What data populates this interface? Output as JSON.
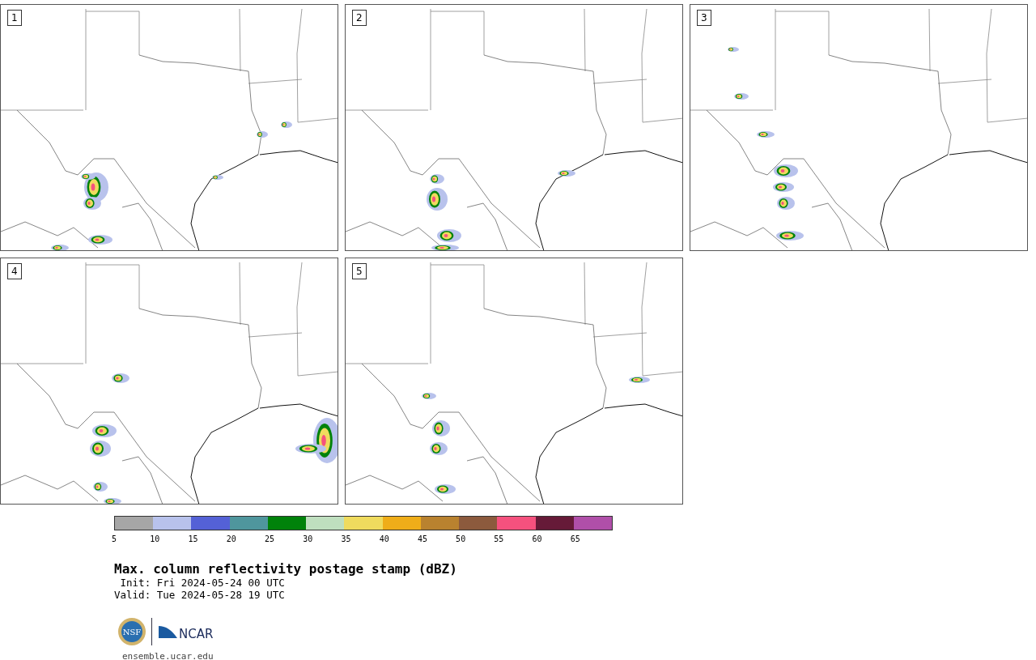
{
  "panels": [
    {
      "label": "1"
    },
    {
      "label": "2"
    },
    {
      "label": "3"
    },
    {
      "label": "4"
    },
    {
      "label": "5"
    }
  ],
  "colorbar": {
    "segments": [
      {
        "color": "#a6a6a6"
      },
      {
        "color": "#b8c2ec"
      },
      {
        "color": "#5461d6"
      },
      {
        "color": "#4f969d"
      },
      {
        "color": "#00820a"
      },
      {
        "color": "#bfdfbf"
      },
      {
        "color": "#efdb5e"
      },
      {
        "color": "#efad19"
      },
      {
        "color": "#b9822f"
      },
      {
        "color": "#8c5a3d"
      },
      {
        "color": "#f5517e"
      },
      {
        "color": "#661a38"
      },
      {
        "color": "#b04fa9"
      }
    ],
    "ticks": [
      "5",
      "10",
      "15",
      "20",
      "25",
      "30",
      "35",
      "40",
      "45",
      "50",
      "55",
      "60",
      "65"
    ]
  },
  "title": "Max. column reflectivity postage stamp (dBZ)",
  "init": " Init: Fri 2024-05-24 00 UTC",
  "valid": "Valid: Tue 2024-05-28 19 UTC",
  "logos": {
    "nsf": "NSF",
    "ncar": "NCAR"
  },
  "url": "ensemble.ucar.edu"
}
